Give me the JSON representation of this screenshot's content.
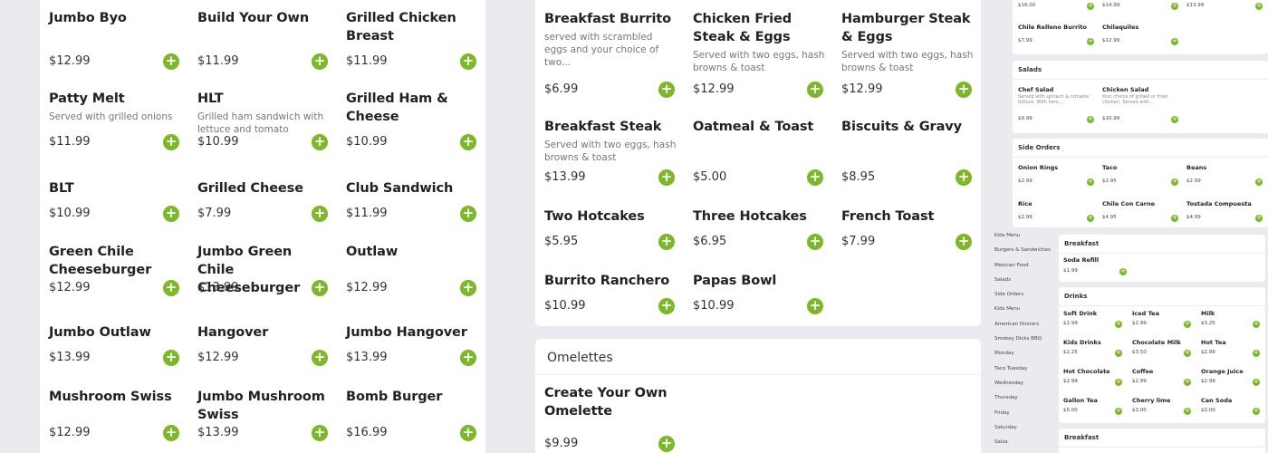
{
  "left": {
    "items": [
      {
        "name": "Jumbo Byo",
        "desc": "",
        "price": "$12.99"
      },
      {
        "name": "Build Your Own",
        "desc": "",
        "price": "$11.99"
      },
      {
        "name": "Grilled Chicken Breast",
        "desc": "",
        "price": "$11.99"
      },
      {
        "name": "Patty Melt",
        "desc": "Served with grilled onions",
        "price": "$11.99"
      },
      {
        "name": "HLT",
        "desc": "Grilled ham sandwich with lettuce and tomato",
        "price": "$10.99"
      },
      {
        "name": "Grilled Ham & Cheese",
        "desc": "",
        "price": "$10.99"
      },
      {
        "name": "BLT",
        "desc": "",
        "price": "$10.99"
      },
      {
        "name": "Grilled Cheese",
        "desc": "",
        "price": "$7.99"
      },
      {
        "name": "Club Sandwich",
        "desc": "",
        "price": "$11.99"
      },
      {
        "name": "Green Chile Cheeseburger",
        "desc": "",
        "price": "$12.99"
      },
      {
        "name": "Jumbo Green Chile Cheeseburger",
        "desc": "",
        "price": "$13.99"
      },
      {
        "name": "Outlaw",
        "desc": "",
        "price": "$12.99"
      },
      {
        "name": "Jumbo Outlaw",
        "desc": "",
        "price": "$13.99"
      },
      {
        "name": "Hangover",
        "desc": "",
        "price": "$12.99"
      },
      {
        "name": "Jumbo Hangover",
        "desc": "",
        "price": "$13.99"
      },
      {
        "name": "Mushroom Swiss",
        "desc": "",
        "price": "$12.99"
      },
      {
        "name": "Jumbo Mushroom Swiss",
        "desc": "",
        "price": "$13.99"
      },
      {
        "name": "Bomb Burger",
        "desc": "",
        "price": "$16.99"
      }
    ]
  },
  "middle": {
    "items": [
      {
        "name": "Breakfast Burrito",
        "desc": "served with scrambled eggs and your choice of two...",
        "price": "$6.99"
      },
      {
        "name": "Chicken Fried Steak & Eggs",
        "desc": "Served with two eggs, hash browns & toast",
        "price": "$12.99"
      },
      {
        "name": "Hamburger Steak & Eggs",
        "desc": "Served with two eggs, hash browns & toast",
        "price": "$12.99"
      },
      {
        "name": "Breakfast Steak",
        "desc": "Served with two eggs, hash browns & toast",
        "price": "$13.99"
      },
      {
        "name": "Oatmeal & Toast",
        "desc": "",
        "price": "$5.00"
      },
      {
        "name": "Biscuits & Gravy",
        "desc": "",
        "price": "$8.95"
      },
      {
        "name": "Two Hotcakes",
        "desc": "",
        "price": "$5.95"
      },
      {
        "name": "Three Hotcakes",
        "desc": "",
        "price": "$6.95"
      },
      {
        "name": "French Toast",
        "desc": "",
        "price": "$7.99"
      },
      {
        "name": "Burrito Ranchero",
        "desc": "",
        "price": "$10.99"
      },
      {
        "name": "Papas Bowl",
        "desc": "",
        "price": "$10.99"
      }
    ]
  },
  "omelettes": {
    "title": "Omelettes",
    "items": [
      {
        "name": "Create Your Own Omelette",
        "desc": "",
        "price": "$9.99"
      }
    ]
  },
  "add_symbol": "+",
  "accent_color": "#7cb82a",
  "thumbnail": {
    "top_prices": [
      "$16.00",
      "$14.99",
      "$13.99"
    ],
    "top_items": [
      {
        "name": "Chile Relleno Burrito",
        "price": "$7.99"
      },
      {
        "name": "Chilaquiles",
        "price": "$12.99"
      }
    ],
    "salads": {
      "title": "Salads",
      "items": [
        {
          "name": "Chef Salad",
          "desc": "Served with spinach & romaine lettuce. With ham,...",
          "price": "$9.99"
        },
        {
          "name": "Chicken Salad",
          "desc": "Your choice of grilled or fried chicken. Served with...",
          "price": "$10.99"
        }
      ]
    },
    "side_orders": {
      "title": "Side Orders",
      "items": [
        {
          "name": "Onion Rings",
          "price": "$2.99"
        },
        {
          "name": "Taco",
          "price": "$2.95"
        },
        {
          "name": "Beans",
          "price": "$2.99"
        },
        {
          "name": "Rice",
          "price": "$2.99"
        },
        {
          "name": "Chile Con Carne",
          "price": "$4.95"
        },
        {
          "name": "Tostada Compuesta",
          "price": "$4.99"
        }
      ]
    },
    "sidebar": [
      "Kids Menu",
      "Burgers & Sandwiches",
      "Mexican Food",
      "Salads",
      "Side Orders",
      "Kids Menu",
      "American Dinners",
      "Smokey Dicks BBQ",
      "Monday",
      "Taco Tuesday",
      "Wednesday",
      "Thursday",
      "Friday",
      "Saturday",
      "Salsa"
    ],
    "breakfast1": {
      "title": "Breakfast",
      "items": [
        {
          "name": "Soda Refill",
          "price": "$1.99"
        }
      ]
    },
    "drinks": {
      "title": "Drinks",
      "items": [
        {
          "name": "Soft Drink",
          "price": "$2.99"
        },
        {
          "name": "Iced Tea",
          "price": "$2.99"
        },
        {
          "name": "Milk",
          "price": "$3.25"
        },
        {
          "name": "Kids Drinks",
          "price": "$2.25"
        },
        {
          "name": "Chocolate Milk",
          "price": "$3.50"
        },
        {
          "name": "Hot Tea",
          "price": "$2.99"
        },
        {
          "name": "Hot Chocolate",
          "price": "$2.99"
        },
        {
          "name": "Coffee",
          "price": "$2.99"
        },
        {
          "name": "Orange Juice",
          "price": "$2.99"
        },
        {
          "name": "Gallon Tea",
          "price": "$5.00"
        },
        {
          "name": "Cherry lime",
          "price": "$3.00"
        },
        {
          "name": "Can Soda",
          "price": "$2.00"
        }
      ]
    },
    "breakfast2": {
      "title": "Breakfast"
    }
  }
}
